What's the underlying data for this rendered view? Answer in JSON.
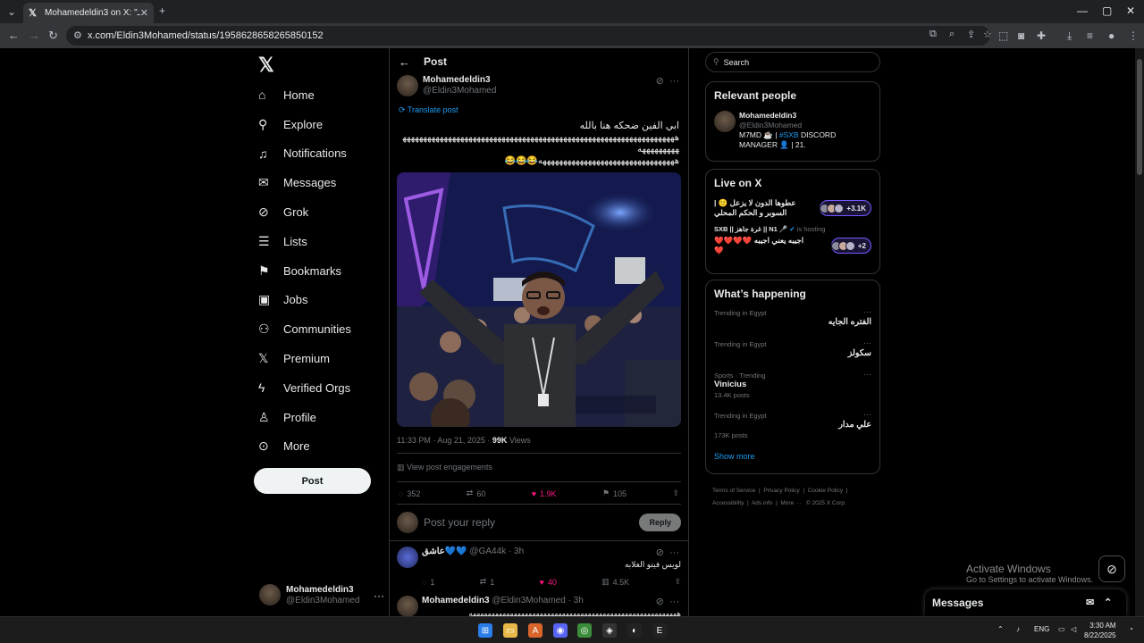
{
  "browser": {
    "tab_title": "Mohamedeldin3 on X: \"ـ",
    "url": "x.com/Eldin3Mohamed/status/1958628658265850152"
  },
  "nav": {
    "items": [
      {
        "icon": "home-icon",
        "label": "Home"
      },
      {
        "icon": "search-icon",
        "label": "Explore"
      },
      {
        "icon": "bell-icon",
        "label": "Notifications"
      },
      {
        "icon": "mail-icon",
        "label": "Messages"
      },
      {
        "icon": "grok-icon",
        "label": "Grok"
      },
      {
        "icon": "list-icon",
        "label": "Lists"
      },
      {
        "icon": "bookmark-icon",
        "label": "Bookmarks"
      },
      {
        "icon": "briefcase-icon",
        "label": "Jobs"
      },
      {
        "icon": "people-icon",
        "label": "Communities"
      },
      {
        "icon": "x-logo-icon",
        "label": "Premium"
      },
      {
        "icon": "lightning-icon",
        "label": "Verified Orgs"
      },
      {
        "icon": "person-icon",
        "label": "Profile"
      },
      {
        "icon": "more-circle-icon",
        "label": "More"
      }
    ],
    "post_button": "Post",
    "account": {
      "name": "Mohamedeldin3",
      "handle": "@Eldin3Mohamed"
    }
  },
  "post": {
    "header": "Post",
    "author": "Mohamedeldin3",
    "handle": "@Eldin3Mohamed",
    "translate": "Translate post",
    "text_line1": "ابي الفين ضحكه هنا بالله",
    "text_line2": "ههههههههههههههههههههههههههههههههههههههههههههههههههههههههههههههههههههههههههههه",
    "text_line3": "هههههههههههههههههههههههههههههههههه😂😂😂",
    "time": "11:33 PM · Aug 21, 2025",
    "views_count": "99K",
    "views_label": "Views",
    "engagements": "View post engagements",
    "replies": "352",
    "reposts": "60",
    "likes": "1.9K",
    "bookmarks": "105",
    "reply_placeholder": "Post your reply",
    "reply_button": "Reply"
  },
  "replies": [
    {
      "name": "عاشق💙💙",
      "handle": "@GA44k · 3h",
      "text": "لويس فيتو الغلابه",
      "replies": "1",
      "reposts": "1",
      "likes": "40",
      "views": "4.5K"
    },
    {
      "name": "Mohamedeldin3",
      "handle": "@Eldin3Mohamed · 3h",
      "text": "ههههههههههههههههههههههههههههههههههههههههههههههههههههههههه"
    }
  ],
  "sidebar": {
    "search_placeholder": "Search",
    "relevant_title": "Relevant people",
    "relevant": {
      "name": "Mohamedeldin3",
      "handle": "@Eldin3Mohamed",
      "bio_pre": "M7MD ☕ | ",
      "bio_tag": "#SXB",
      "bio_post": " DISCORD MANAGER 👤 | 21."
    },
    "live_title": "Live on X",
    "live": [
      {
        "title": "عطوها الدون لا يزعل 🙁 | السوبر و الحكم المحلي",
        "count": "+3.1K"
      },
      {
        "host": "SXB || غرة جاهز || N1 🎤",
        "hosting": "is hosting",
        "title": "اجيبه يعني اجيبه ❤️❤️❤️❤️❤️",
        "count": "+2"
      }
    ],
    "happening_title": "What’s happening",
    "trends": [
      {
        "context": "Trending in Egypt",
        "name": "الفتره الجايه",
        "posts": ""
      },
      {
        "context": "Trending in Egypt",
        "name": "سكولز",
        "posts": ""
      },
      {
        "context": "Sports · Trending",
        "name": "Vinicius",
        "posts": "13.4K posts"
      },
      {
        "context": "Trending in Egypt",
        "name": "علي مدار",
        "posts": "173K posts"
      }
    ],
    "show_more": "Show more",
    "footer": [
      "Terms of Service",
      "Privacy Policy",
      "Cookie Policy",
      "Accessibility",
      "Ads info",
      "More ···",
      "© 2025 X Corp."
    ]
  },
  "overlay": {
    "activate_title": "Activate Windows",
    "activate_sub": "Go to Settings to activate Windows.",
    "messages_title": "Messages"
  },
  "taskbar": {
    "lang": "ENG",
    "time": "3:30 AM",
    "date": "8/22/2025"
  }
}
